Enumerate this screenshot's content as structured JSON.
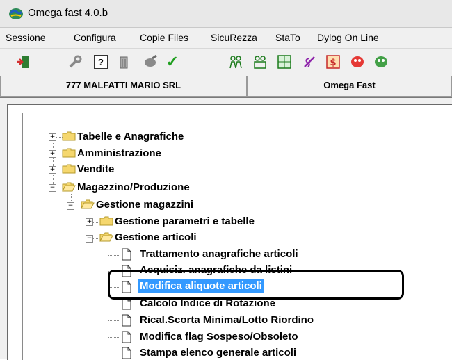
{
  "window": {
    "title": "Omega fast  4.0.b",
    "app_icon": "globe-icon"
  },
  "menu": [
    "Sessione",
    "Configura",
    "Copie Files",
    "SicuRezza",
    "StaTo",
    "Dylog On Line"
  ],
  "toolbar": {
    "icons": [
      "exit-door-icon",
      "wrench-icon",
      "help-icon",
      "trash-icon",
      "tool-icon",
      "check-icon",
      "users-icon",
      "users-search-icon",
      "grid-help-icon",
      "currency-icon",
      "dollar-icon",
      "red-mask-icon",
      "green-mask-icon"
    ],
    "help_glyph": "?",
    "check_glyph": "✓"
  },
  "status": {
    "company": "777 MALFATTI MARIO SRL",
    "product": "Omega Fast"
  },
  "tree": {
    "level0": [
      {
        "label": "Tabelle e Anagrafiche",
        "expanded": false
      },
      {
        "label": "Amministrazione",
        "expanded": false
      },
      {
        "label": "Vendite",
        "expanded": false
      },
      {
        "label": "Magazzino/Produzione",
        "expanded": true
      }
    ],
    "level1": [
      {
        "label": "Gestione magazzini",
        "expanded": true
      }
    ],
    "level2": [
      {
        "label": "Gestione parametri e tabelle",
        "expanded": false
      },
      {
        "label": "Gestione articoli",
        "expanded": true
      }
    ],
    "leaves": [
      "Trattamento anagrafiche articoli",
      "Acquisiz. anagrafiche da listini",
      "Modifica aliquote articoli",
      "Calcolo Indice di Rotazione",
      "Rical.Scorta Minima/Lotto Riordino",
      "Modifica flag Sospeso/Obsoleto",
      "Stampa elenco generale articoli"
    ],
    "selected_leaf": "Modifica aliquote articoli",
    "expand_glyph": "+",
    "collapse_glyph": "−"
  },
  "colors": {
    "selection": "#3399ff",
    "folder": "#f5d76e",
    "window_bg": "#f0f0f0"
  }
}
